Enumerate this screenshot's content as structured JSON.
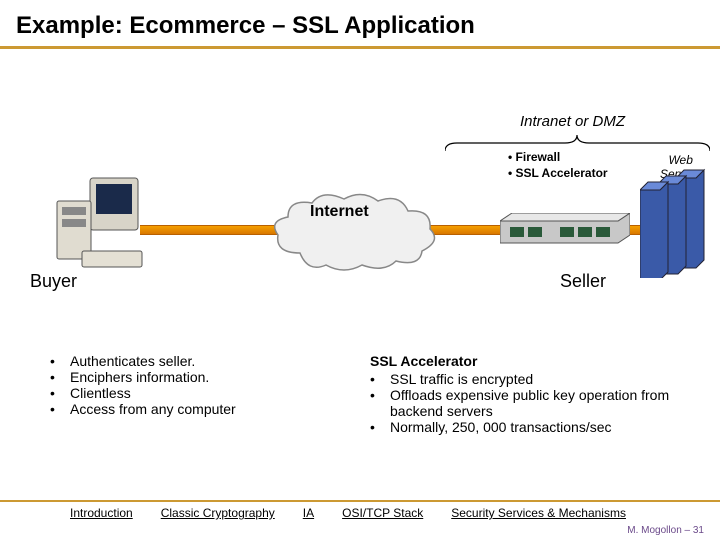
{
  "title": "Example: Ecommerce – SSL Application",
  "labels": {
    "intranet": "Intranet or DMZ",
    "fw1": "• Firewall",
    "fw2": "• SSL Accelerator",
    "web1": "Web",
    "web2": "Servers",
    "internet": "Internet",
    "buyer": "Buyer",
    "seller": "Seller"
  },
  "buyer_bullets": [
    "Authenticates seller.",
    "Enciphers information.",
    "Clientless",
    "Access from any computer"
  ],
  "ssl": {
    "heading": "SSL Accelerator",
    "bullets": [
      "SSL traffic is encrypted",
      "Offloads expensive public key operation from backend servers",
      "Normally, 250, 000 transactions/sec"
    ]
  },
  "footer": {
    "links": [
      "Introduction",
      "Classic Cryptography",
      "IA",
      "OSI/TCP Stack",
      "Security Services & Mechanisms"
    ],
    "attr": "M. Mogollon – 31"
  }
}
